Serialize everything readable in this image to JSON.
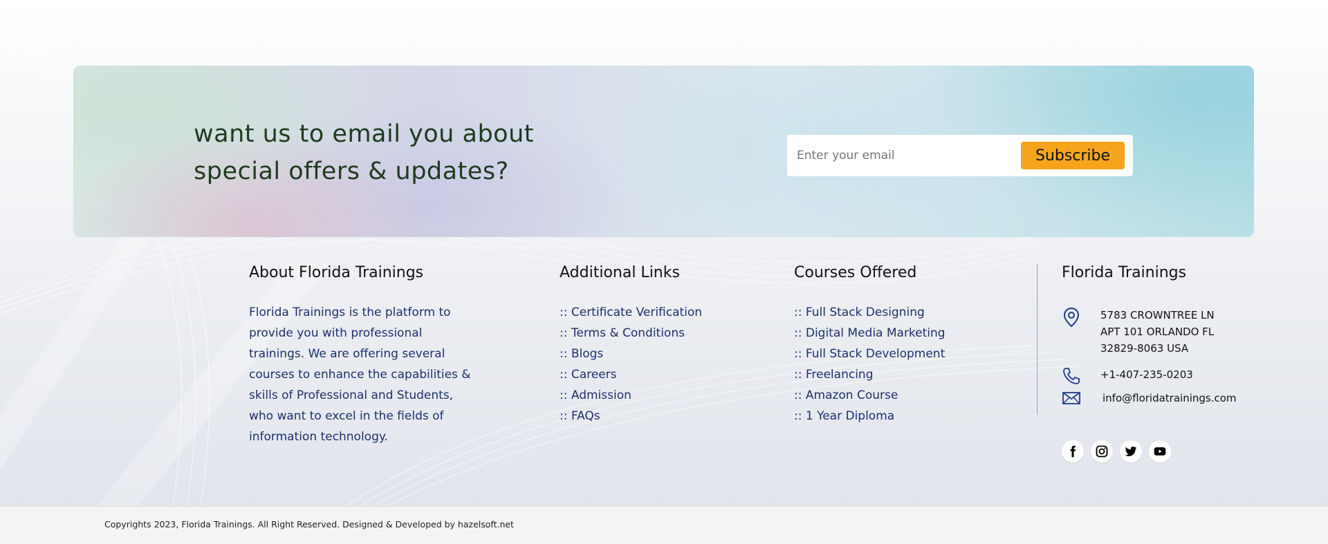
{
  "newsletter": {
    "heading_line1": "want us to email you about",
    "heading_line2": "special offers & updates?",
    "email_placeholder": "Enter your email",
    "subscribe_label": "Subscribe"
  },
  "about": {
    "title": "About Florida Trainings",
    "text": "Florida Trainings is the platform to provide you with professional trainings. We are offering several courses to enhance the capabilities & skills of Professional and Students, who want to excel in the fields of information technology."
  },
  "additional_links": {
    "title": "Additional Links",
    "items": [
      {
        "label": ":: Certificate Verification"
      },
      {
        "label": ":: Terms & Conditions"
      },
      {
        "label": ":: Blogs"
      },
      {
        "label": ":: Careers"
      },
      {
        "label": ":: Admission"
      },
      {
        "label": ":: FAQs"
      }
    ]
  },
  "courses": {
    "title": "Courses Offered",
    "items": [
      {
        "label": ":: Full Stack Designing"
      },
      {
        "label": ":: Digital Media Marketing"
      },
      {
        "label": ":: Full Stack Development"
      },
      {
        "label": ":: Freelancing"
      },
      {
        "label": ":: Amazon Course"
      },
      {
        "label": ":: 1 Year Diploma"
      }
    ]
  },
  "contact": {
    "title": "Florida Trainings",
    "address_line1": "5783 CROWNTREE LN",
    "address_line2": "APT 101 ORLANDO FL",
    "address_line3": "32829-8063 USA",
    "phone": "+1-407-235-0203",
    "email": "info@floridatrainings.com",
    "icons": {
      "address": "map-pin-icon",
      "phone": "phone-icon",
      "email": "envelope-icon"
    },
    "icon_color": "#1e3a8a"
  },
  "social": [
    {
      "icon": "facebook-icon"
    },
    {
      "icon": "instagram-icon"
    },
    {
      "icon": "twitter-icon"
    },
    {
      "icon": "youtube-icon"
    }
  ],
  "footer": {
    "copyright": "Copyrights 2023, Florida Trainings. All Right Reserved. Designed & Developed by hazelsoft.net"
  },
  "colors": {
    "accent": "#f5a41c",
    "link_text": "#1e2f6a",
    "heading_green": "#1f3a1f"
  }
}
